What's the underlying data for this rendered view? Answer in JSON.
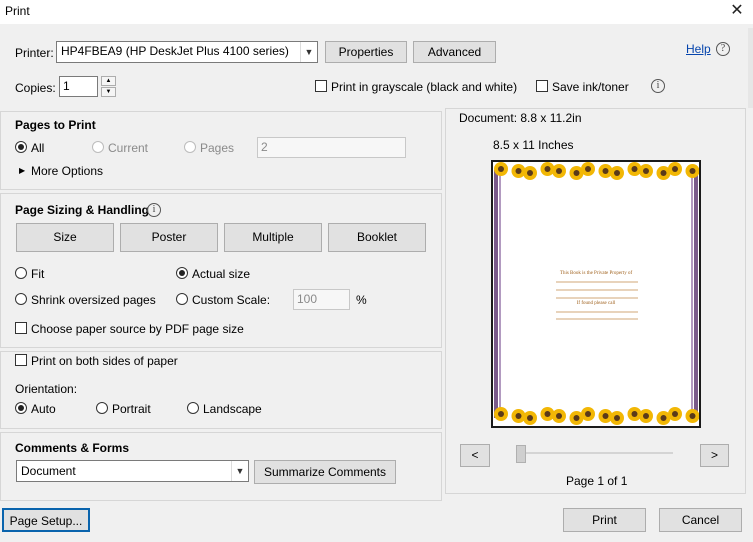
{
  "window": {
    "title": "Print",
    "close_glyph": "✕"
  },
  "printer": {
    "label": "Printer:",
    "value": "HP4FBEA9 (HP DeskJet Plus 4100 series)",
    "properties": "Properties",
    "advanced": "Advanced"
  },
  "help": {
    "label": "Help",
    "icon_glyph": "?"
  },
  "copies": {
    "label": "Copies:",
    "value": "1",
    "grayscale": "Print in grayscale (black and white)",
    "save_ink": "Save ink/toner"
  },
  "pages": {
    "title": "Pages to Print",
    "all": "All",
    "current": "Current",
    "pages_label": "Pages",
    "pages_value": "2",
    "more_options": "More Options"
  },
  "sizing": {
    "title": "Page Sizing & Handling",
    "buttons": [
      "Size",
      "Poster",
      "Multiple",
      "Booklet"
    ],
    "fit": "Fit",
    "actual_size": "Actual size",
    "shrink": "Shrink oversized pages",
    "custom_scale": "Custom Scale:",
    "scale_value": "100",
    "percent": "%",
    "paper_source": "Choose paper source by PDF page size"
  },
  "duplex": {
    "both_sides": "Print on both sides of paper",
    "orientation_label": "Orientation:",
    "auto": "Auto",
    "portrait": "Portrait",
    "landscape": "Landscape"
  },
  "comments": {
    "title": "Comments & Forms",
    "value": "Document",
    "summarize": "Summarize Comments"
  },
  "preview": {
    "document_size": "Document: 8.8 x 11.2in",
    "paper_size": "8.5 x 11 Inches",
    "page_line1": "This Book is the Private Property of",
    "page_line2": "If found please call",
    "prev": "<",
    "next": ">",
    "page_info": "Page 1 of 1"
  },
  "footer": {
    "page_setup": "Page Setup...",
    "print": "Print",
    "cancel": "Cancel"
  },
  "colors": {
    "sunflower_petal": "#f2b705",
    "sunflower_center": "#5a3a1a",
    "border_purple": "#7a5a8a",
    "text_brown": "#a0621e"
  }
}
